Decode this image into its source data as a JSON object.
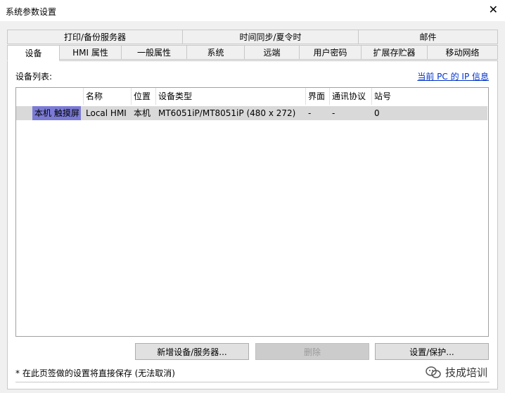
{
  "window": {
    "title": "系统参数设置",
    "close_glyph": "✕"
  },
  "tabs_top": [
    "打印/备份服务器",
    "时间同步/夏令时",
    "邮件"
  ],
  "tabs_bottom": [
    "设备",
    "HMI 属性",
    "一般属性",
    "系统",
    "远端",
    "用户密码",
    "扩展存贮器",
    "移动网络"
  ],
  "active_tab": "设备",
  "device_list": {
    "label": "设备列表:",
    "ip_link": "当前 PC 的 IP 信息",
    "columns": [
      "",
      "名称",
      "位置",
      "设备类型",
      "界面",
      "通讯协议",
      "站号"
    ],
    "rows": [
      [
        "本机 触摸屏",
        "Local HMI",
        "本机",
        "MT6051iP/MT8051iP (480 x 272)",
        "-",
        "-",
        "0"
      ]
    ]
  },
  "buttons": {
    "add": "新增设备/服务器...",
    "delete": "删除",
    "settings": "设置/保护..."
  },
  "note": "* 在此页签做的设置将直接保存 (无法取消)",
  "watermark": "技成培训",
  "colors": {
    "selected_cell": "#7b7bd6",
    "row_highlight": "#d9d9d9",
    "link": "#0033cc"
  }
}
